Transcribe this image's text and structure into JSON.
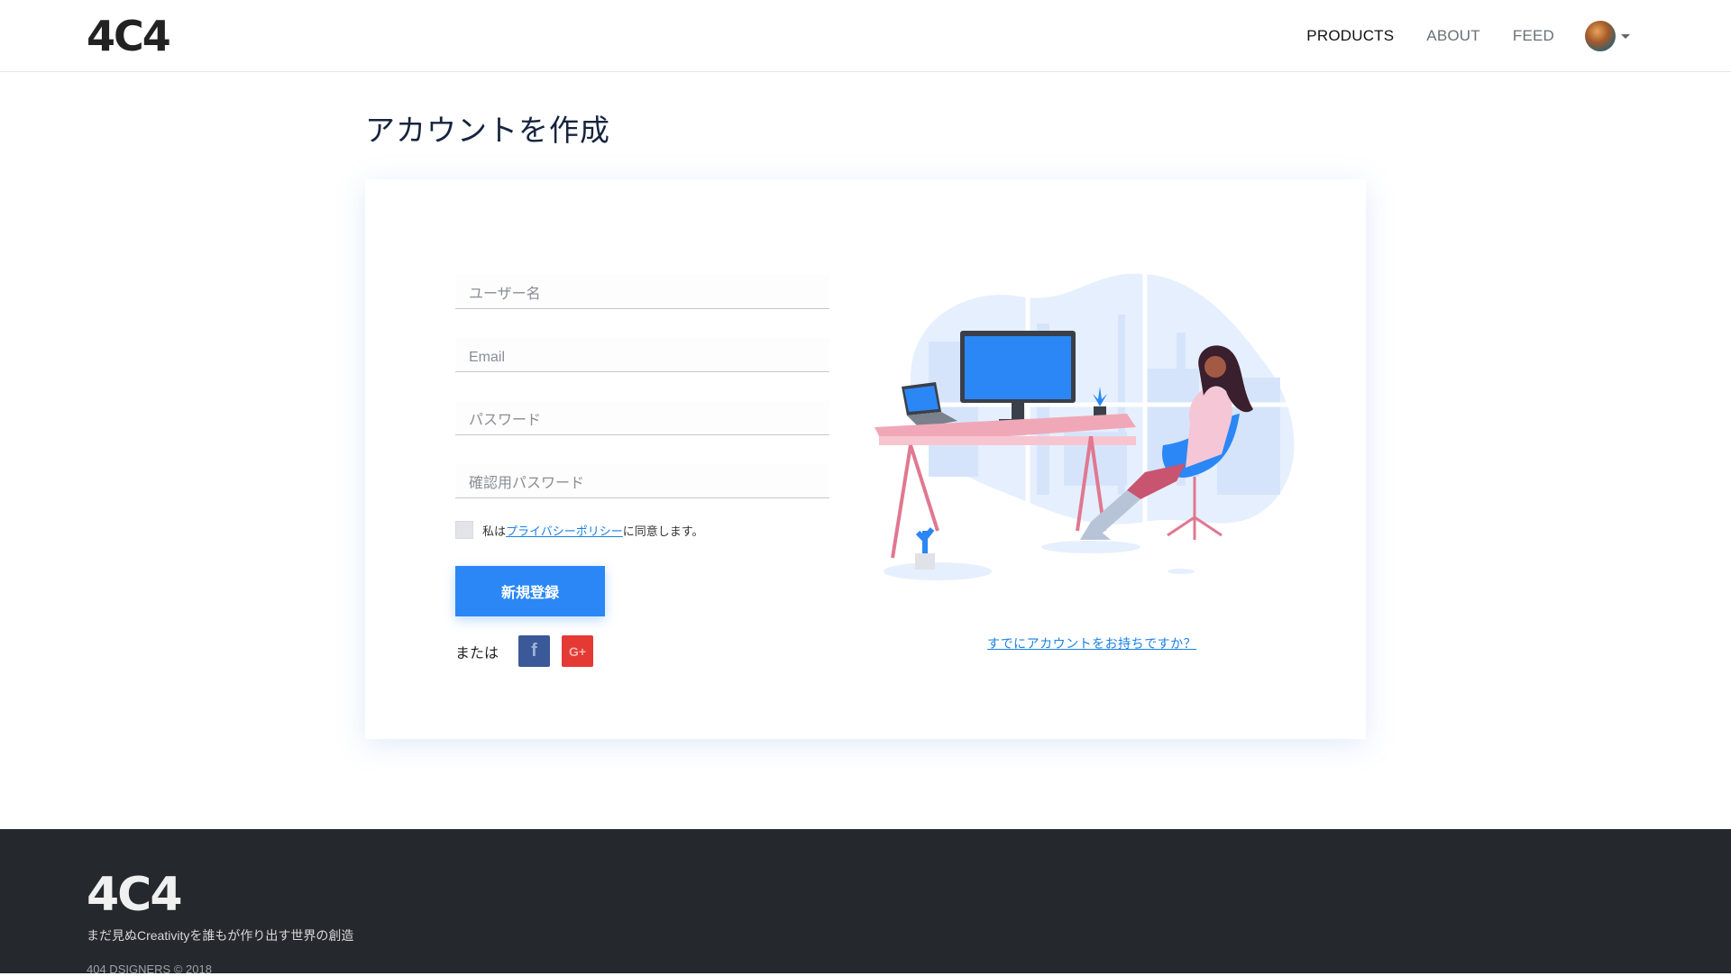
{
  "header": {
    "logo": "4C4",
    "nav": [
      {
        "label": "PRODUCTS",
        "active": true
      },
      {
        "label": "ABOUT",
        "active": false
      },
      {
        "label": "FEED",
        "active": false
      }
    ]
  },
  "page": {
    "title": "アカウントを作成"
  },
  "form": {
    "username_placeholder": "ユーザー名",
    "email_placeholder": "Email",
    "password_placeholder": "パスワード",
    "confirm_placeholder": "確認用パスワード",
    "agree_prefix": "私は",
    "agree_link": "プライバシーポリシー",
    "agree_suffix": "に同意します。",
    "agree_checked": false,
    "submit_label": "新規登録",
    "or_label": "または",
    "facebook_glyph": "f",
    "google_glyph": "G+"
  },
  "side": {
    "login_link": "すでにアカウントをお持ちですか？"
  },
  "footer": {
    "logo": "4C4",
    "tagline": "まだ見ぬCreativityを誰もが作り出す世界の創造",
    "copyright": "404 DSIGNERS © 2018"
  },
  "colors": {
    "accent": "#2a87f5",
    "title": "#16243f",
    "footer_bg": "#25282c",
    "facebook": "#3b5998",
    "google": "#e53935"
  },
  "icons": [
    "facebook-icon",
    "google-plus-icon",
    "chevron-down-icon"
  ]
}
